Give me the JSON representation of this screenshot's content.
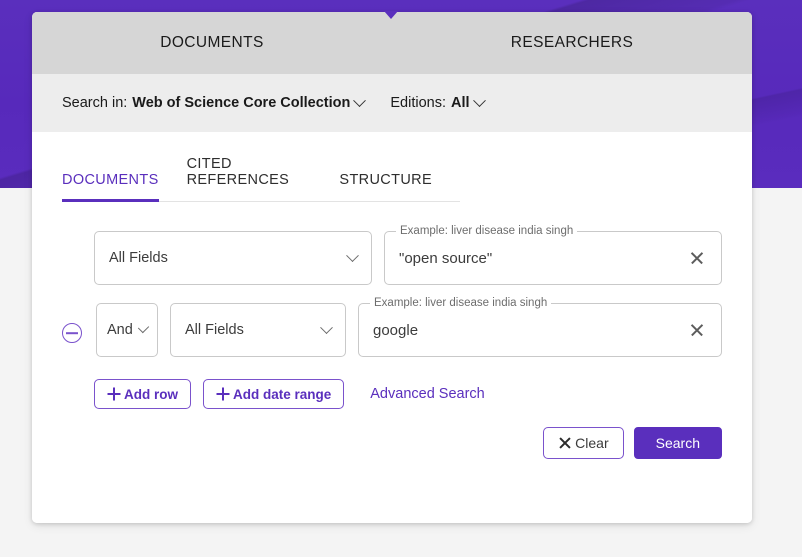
{
  "banner": {
    "accent_color": "#5a2fbd"
  },
  "top_tabs": [
    {
      "label": "DOCUMENTS",
      "active": true
    },
    {
      "label": "RESEARCHERS",
      "active": false
    }
  ],
  "search_in": {
    "label": "Search in:",
    "database": "Web of Science Core Collection",
    "editions_label": "Editions:",
    "editions_value": "All"
  },
  "sub_tabs": [
    {
      "label": "DOCUMENTS",
      "active": true
    },
    {
      "label": "CITED REFERENCES",
      "active": false
    },
    {
      "label": "STRUCTURE",
      "active": false
    }
  ],
  "rows": [
    {
      "field": "All Fields",
      "query_label": "Example: liver disease india singh",
      "query_value": "\"open source\""
    },
    {
      "operator": "And",
      "field": "All Fields",
      "query_label": "Example: liver disease india singh",
      "query_value": "google"
    }
  ],
  "actions": {
    "add_row": "Add row",
    "add_date_range": "Add date range",
    "advanced_search": "Advanced Search"
  },
  "submit": {
    "clear": "Clear",
    "search": "Search"
  }
}
